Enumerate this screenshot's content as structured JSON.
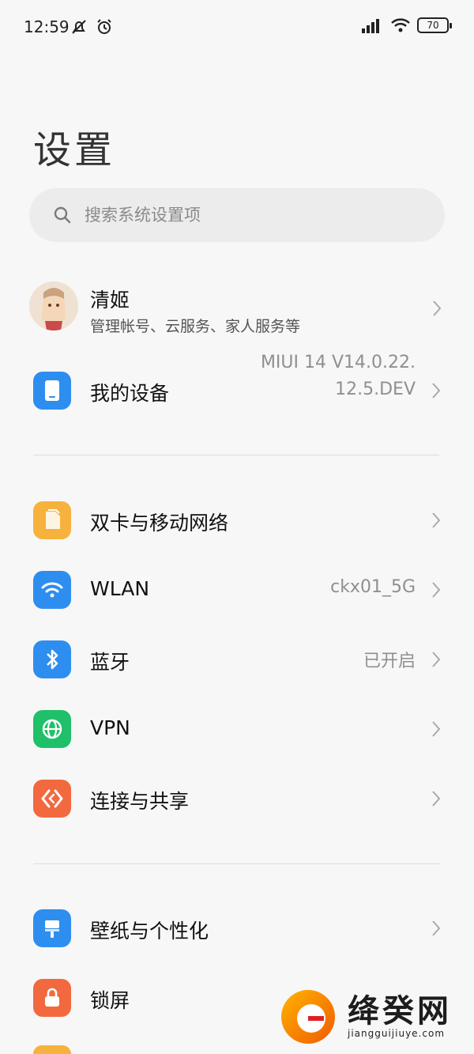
{
  "status_bar": {
    "time": "12:59",
    "battery": "70"
  },
  "page": {
    "title": "设置"
  },
  "search": {
    "placeholder": "搜索系统设置项"
  },
  "account": {
    "name": "清姬",
    "subtitle": "管理帐号、云服务、家人服务等"
  },
  "items": {
    "my_device": {
      "label": "我的设备",
      "value_line1": "MIUI 14 V14.0.22.",
      "value_line2": "12.5.DEV",
      "icon": "phone-icon",
      "color": "#2d8ef0"
    },
    "sim": {
      "label": "双卡与移动网络",
      "icon": "sim-card-icon",
      "color": "#f7b23d"
    },
    "wlan": {
      "label": "WLAN",
      "value": "ckx01_5G",
      "icon": "wifi-icon",
      "color": "#2d8ef0"
    },
    "bluetooth": {
      "label": "蓝牙",
      "value": "已开启",
      "icon": "bluetooth-icon",
      "color": "#2d8ef0"
    },
    "vpn": {
      "label": "VPN",
      "icon": "globe-icon",
      "color": "#1fc069"
    },
    "connection": {
      "label": "连接与共享",
      "icon": "share-icon",
      "color": "#f2693f"
    },
    "wallpaper": {
      "label": "壁纸与个性化",
      "icon": "paint-brush-icon",
      "color": "#2d8ef0"
    },
    "lockscreen": {
      "label": "锁屏",
      "icon": "lock-icon",
      "color": "#f2693f"
    }
  },
  "watermark": {
    "text": "绛癸网",
    "url": "jiangguijiuye.com"
  }
}
